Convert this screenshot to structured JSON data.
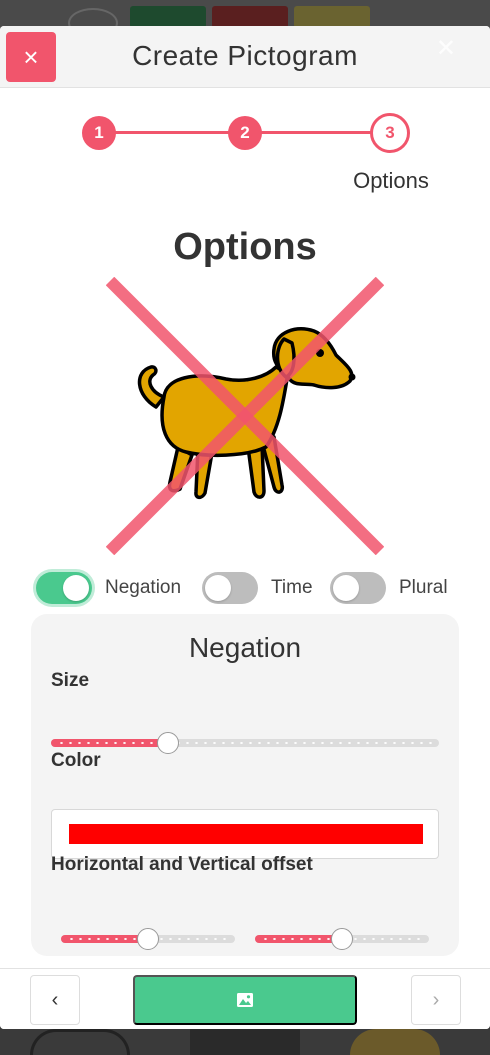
{
  "header": {
    "title": "Create Pictogram",
    "close_label": "×",
    "ghost_close_label": "✕"
  },
  "stepper": {
    "steps": [
      {
        "number": "1"
      },
      {
        "number": "2"
      },
      {
        "number": "3"
      }
    ],
    "current_label": "Options"
  },
  "section_title": "Options",
  "toggles": {
    "negation": {
      "label": "Negation",
      "on": true
    },
    "time": {
      "label": "Time",
      "on": false
    },
    "plural": {
      "label": "Plural",
      "on": false
    }
  },
  "panel": {
    "title": "Negation",
    "size_label": "Size",
    "size_value": 0.29,
    "color_label": "Color",
    "color_value": "#ff0000",
    "offset_label": "Horizontal and Vertical offset",
    "h_offset_value": 0.5,
    "v_offset_value": 0.5
  },
  "footer": {
    "prev_label": "‹",
    "next_label": "›"
  },
  "colors": {
    "accent": "#f1556c",
    "success": "#4ac98e",
    "dog_fill": "#e2a500",
    "cross": "#f1556c"
  }
}
